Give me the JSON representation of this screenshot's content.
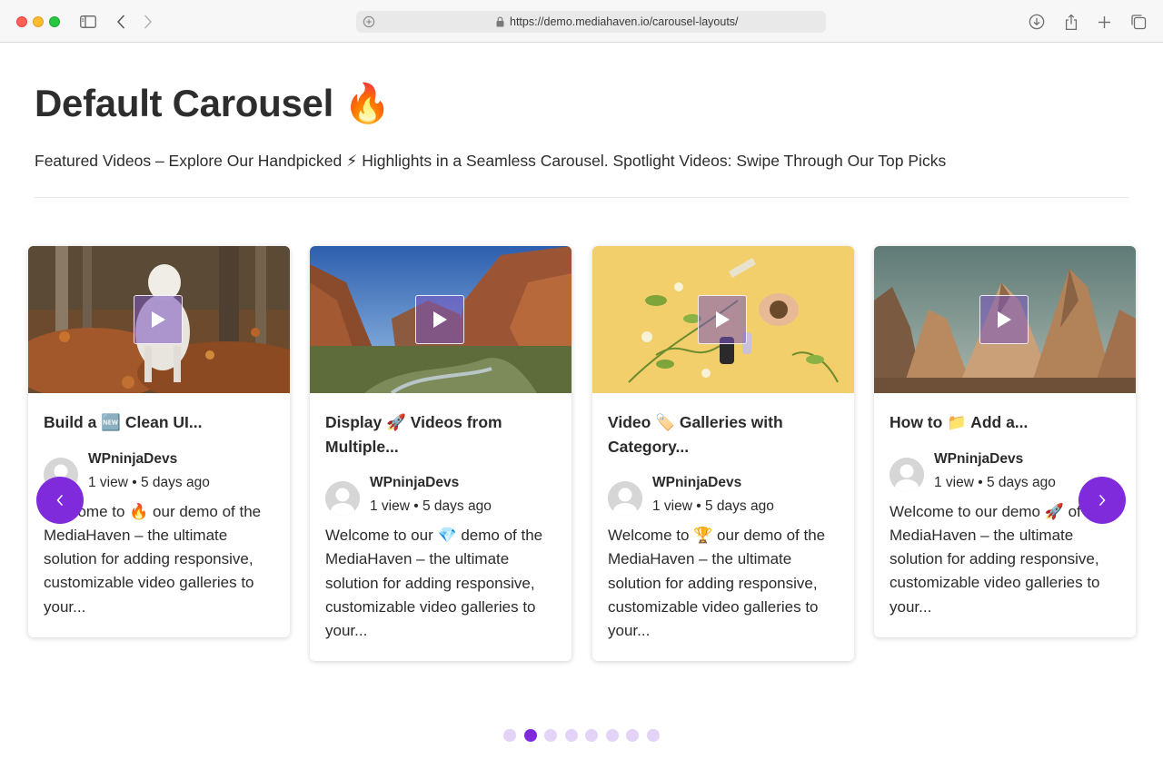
{
  "browser": {
    "url": "https://demo.mediahaven.io/carousel-layouts/",
    "icons": [
      "sidebar-icon",
      "back-icon",
      "forward-icon",
      "site-settings-icon",
      "lock-icon",
      "download-icon",
      "share-icon",
      "new-tab-icon",
      "tabs-overview-icon"
    ]
  },
  "page": {
    "title": "Default Carousel 🔥",
    "subtitle": "Featured Videos – Explore Our Handpicked ⚡ Highlights in a Seamless Carousel. Spotlight Videos: Swipe Through Our Top Picks"
  },
  "cards": [
    {
      "title": "Build a 🆕 Clean UI...",
      "author": "WPninjaDevs",
      "views": "1 view",
      "age": "5 days ago",
      "description": "Welcome to 🔥 our demo of the MediaHaven – the ultimate solution for adding responsive, customizable video galleries to your...",
      "thumbnail": "wolf-in-autumn-forest"
    },
    {
      "title": "Display 🚀 Videos from Multiple...",
      "author": "WPninjaDevs",
      "views": "1 view",
      "age": "5 days ago",
      "description": "Welcome to our 💎 demo of the MediaHaven – the ultimate solution for adding responsive, customizable video galleries to your...",
      "thumbnail": "canyon-river-valley"
    },
    {
      "title": "Video 🏷️ Galleries with Category...",
      "author": "WPninjaDevs",
      "views": "1 view",
      "age": "5 days ago",
      "description": "Welcome to 🏆 our demo of the MediaHaven – the ultimate solution for adding responsive, customizable video galleries to your...",
      "thumbnail": "herbs-and-bottles-on-yellow"
    },
    {
      "title": "How to 📁 Add a...",
      "author": "WPninjaDevs",
      "views": "1 view",
      "age": "5 days ago",
      "description": "Welcome to our demo 🚀 of the MediaHaven – the ultimate solution for adding responsive, customizable video galleries to your...",
      "thumbnail": "rock-formations"
    }
  ],
  "carousel": {
    "stat_separator": "•",
    "prev_icon": "chevron-left-icon",
    "next_icon": "chevron-right-icon",
    "dot_count": 8,
    "active_dot": 2
  },
  "colors": {
    "accent": "#7f2bdc",
    "dot_inactive": "#e2d3f7",
    "text": "#2b2b2b"
  }
}
